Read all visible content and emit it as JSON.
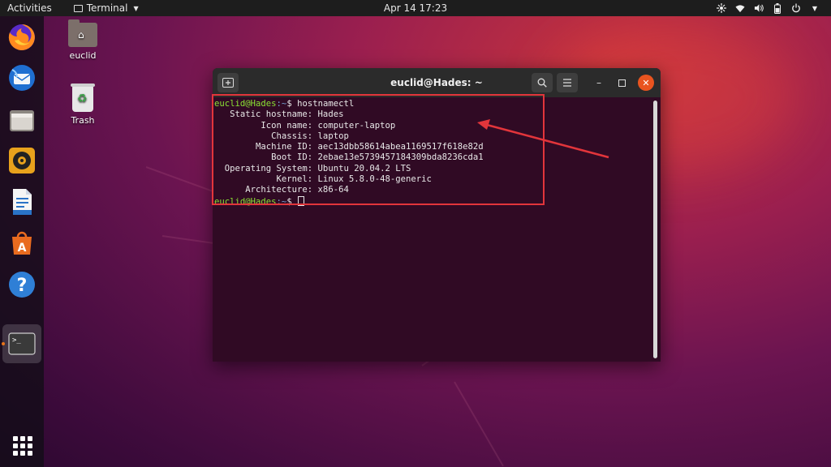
{
  "topbar": {
    "activities": "Activities",
    "app_name": "Terminal",
    "clock": "Apr 14  17:23",
    "tray_icons": [
      "network-icon",
      "wifi-icon",
      "volume-icon",
      "battery-icon",
      "power-icon"
    ]
  },
  "dock": {
    "items": [
      "firefox-icon",
      "thunderbird-icon",
      "files-icon",
      "rhythmbox-icon",
      "writer-icon",
      "software-icon",
      "help-icon",
      "terminal-icon"
    ],
    "active": "terminal-icon",
    "show_apps_icon": "grid-icon"
  },
  "desktop": {
    "icons": [
      {
        "label": "euclid",
        "icon": "home-folder-icon"
      },
      {
        "label": "Trash",
        "icon": "trash-icon"
      }
    ]
  },
  "terminal": {
    "title": "euclid@Hades: ~",
    "prompt_user": "euclid@Hades",
    "prompt_path": ":~",
    "prompt_symbol": "$ ",
    "command": "hostnamectl",
    "output": [
      "   Static hostname: Hades",
      "         Icon name: computer-laptop",
      "           Chassis: laptop",
      "        Machine ID: aec13dbb58614abea1169517f618e82d",
      "           Boot ID: 2ebae13e5739457184309bda8236cda1",
      "  Operating System: Ubuntu 20.04.2 LTS",
      "            Kernel: Linux 5.8.0-48-generic",
      "      Architecture: x86-64"
    ]
  },
  "colors": {
    "terminal_bg": "#300a24",
    "prompt_user": "#8ae234",
    "prompt_path": "#729fcf",
    "annotation_red": "#e2353b",
    "close_button": "#e9541f"
  }
}
